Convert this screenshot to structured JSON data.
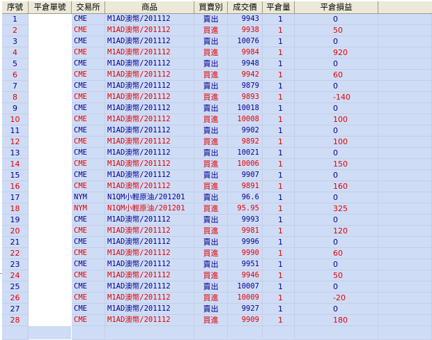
{
  "columns": [
    {
      "key": "seq",
      "label": "序號"
    },
    {
      "key": "close_order",
      "label": "平倉單號"
    },
    {
      "key": "exchange",
      "label": "交易所"
    },
    {
      "key": "product",
      "label": "商品"
    },
    {
      "key": "side",
      "label": "買賣別"
    },
    {
      "key": "price",
      "label": "成交價"
    },
    {
      "key": "close_qty",
      "label": "平倉量"
    },
    {
      "key": "pnl",
      "label": "平倉損益"
    }
  ],
  "colors": {
    "buy": "#e00000",
    "sell": "#000090",
    "row_bg": "#cfdcf6",
    "header_bg": "#ece9d8"
  },
  "rows": [
    {
      "seq": "1",
      "close_order": "",
      "exchange": "CME",
      "product": "M1AD澳幣/201112",
      "side": "賣出",
      "price": "9943",
      "close_qty": "1",
      "pnl": "0"
    },
    {
      "seq": "2",
      "close_order": "",
      "exchange": "CME",
      "product": "M1AD澳幣/201112",
      "side": "買進",
      "price": "9938",
      "close_qty": "1",
      "pnl": "50"
    },
    {
      "seq": "3",
      "close_order": "",
      "exchange": "CME",
      "product": "M1AD澳幣/201112",
      "side": "賣出",
      "price": "10076",
      "close_qty": "1",
      "pnl": "0"
    },
    {
      "seq": "4",
      "close_order": "",
      "exchange": "CME",
      "product": "M1AD澳幣/201112",
      "side": "買進",
      "price": "9984",
      "close_qty": "1",
      "pnl": "920"
    },
    {
      "seq": "5",
      "close_order": "",
      "exchange": "CME",
      "product": "M1AD澳幣/201112",
      "side": "賣出",
      "price": "9948",
      "close_qty": "1",
      "pnl": "0"
    },
    {
      "seq": "6",
      "close_order": "",
      "exchange": "CME",
      "product": "M1AD澳幣/201112",
      "side": "買進",
      "price": "9942",
      "close_qty": "1",
      "pnl": "60"
    },
    {
      "seq": "7",
      "close_order": "",
      "exchange": "CME",
      "product": "M1AD澳幣/201112",
      "side": "賣出",
      "price": "9879",
      "close_qty": "1",
      "pnl": "0"
    },
    {
      "seq": "8",
      "close_order": "",
      "exchange": "CME",
      "product": "M1AD澳幣/201112",
      "side": "買進",
      "price": "9893",
      "close_qty": "1",
      "pnl": "-140"
    },
    {
      "seq": "9",
      "close_order": "",
      "exchange": "CME",
      "product": "M1AD澳幣/201112",
      "side": "賣出",
      "price": "10018",
      "close_qty": "1",
      "pnl": "0"
    },
    {
      "seq": "10",
      "close_order": "",
      "exchange": "CME",
      "product": "M1AD澳幣/201112",
      "side": "買進",
      "price": "10008",
      "close_qty": "1",
      "pnl": "100"
    },
    {
      "seq": "11",
      "close_order": "",
      "exchange": "CME",
      "product": "M1AD澳幣/201112",
      "side": "賣出",
      "price": "9902",
      "close_qty": "1",
      "pnl": "0"
    },
    {
      "seq": "12",
      "close_order": "",
      "exchange": "CME",
      "product": "M1AD澳幣/201112",
      "side": "買進",
      "price": "9892",
      "close_qty": "1",
      "pnl": "100"
    },
    {
      "seq": "13",
      "close_order": "",
      "exchange": "CME",
      "product": "M1AD澳幣/201112",
      "side": "賣出",
      "price": "10021",
      "close_qty": "1",
      "pnl": "0"
    },
    {
      "seq": "14",
      "close_order": "",
      "exchange": "CME",
      "product": "M1AD澳幣/201112",
      "side": "買進",
      "price": "10006",
      "close_qty": "1",
      "pnl": "150"
    },
    {
      "seq": "15",
      "close_order": "",
      "exchange": "CME",
      "product": "M1AD澳幣/201112",
      "side": "賣出",
      "price": "9907",
      "close_qty": "1",
      "pnl": "0"
    },
    {
      "seq": "16",
      "close_order": "",
      "exchange": "CME",
      "product": "M1AD澳幣/201112",
      "side": "買進",
      "price": "9891",
      "close_qty": "1",
      "pnl": "160"
    },
    {
      "seq": "17",
      "close_order": "",
      "exchange": "NYM",
      "product": "N1QM小輕原油/201201",
      "side": "賣出",
      "price": "96.6",
      "close_qty": "1",
      "pnl": "0"
    },
    {
      "seq": "18",
      "close_order": "",
      "exchange": "NYM",
      "product": "N1QM小輕原油/201201",
      "side": "買進",
      "price": "95.95",
      "close_qty": "1",
      "pnl": "325"
    },
    {
      "seq": "19",
      "close_order": "",
      "exchange": "CME",
      "product": "M1AD澳幣/201112",
      "side": "賣出",
      "price": "9993",
      "close_qty": "1",
      "pnl": "0"
    },
    {
      "seq": "20",
      "close_order": "",
      "exchange": "CME",
      "product": "M1AD澳幣/201112",
      "side": "買進",
      "price": "9981",
      "close_qty": "1",
      "pnl": "120"
    },
    {
      "seq": "21",
      "close_order": "",
      "exchange": "CME",
      "product": "M1AD澳幣/201112",
      "side": "賣出",
      "price": "9996",
      "close_qty": "1",
      "pnl": "0"
    },
    {
      "seq": "22",
      "close_order": "",
      "exchange": "CME",
      "product": "M1AD澳幣/201112",
      "side": "買進",
      "price": "9990",
      "close_qty": "1",
      "pnl": "60"
    },
    {
      "seq": "23",
      "close_order": "",
      "exchange": "CME",
      "product": "M1AD澳幣/201112",
      "side": "賣出",
      "price": "9951",
      "close_qty": "1",
      "pnl": "0"
    },
    {
      "seq": "24",
      "close_order": "",
      "exchange": "CME",
      "product": "M1AD澳幣/201112",
      "side": "買進",
      "price": "9946",
      "close_qty": "1",
      "pnl": "50"
    },
    {
      "seq": "25",
      "close_order": "",
      "exchange": "CME",
      "product": "M1AD澳幣/201112",
      "side": "賣出",
      "price": "10007",
      "close_qty": "1",
      "pnl": "0"
    },
    {
      "seq": "26",
      "close_order": "",
      "exchange": "CME",
      "product": "M1AD澳幣/201112",
      "side": "買進",
      "price": "10009",
      "close_qty": "1",
      "pnl": "-20"
    },
    {
      "seq": "27",
      "close_order": "",
      "exchange": "CME",
      "product": "M1AD澳幣/201112",
      "side": "賣出",
      "price": "9927",
      "close_qty": "1",
      "pnl": "0"
    },
    {
      "seq": "28",
      "close_order": "",
      "exchange": "CME",
      "product": "M1AD澳幣/201112",
      "side": "買進",
      "price": "9909",
      "close_qty": "1",
      "pnl": "180"
    }
  ]
}
